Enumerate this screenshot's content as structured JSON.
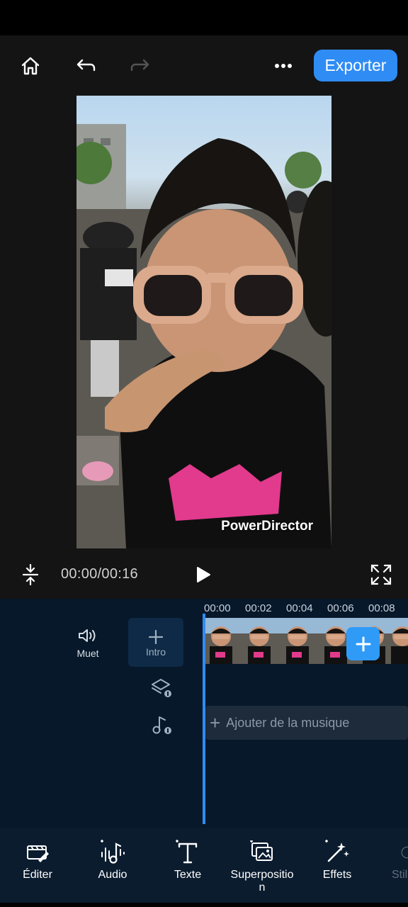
{
  "header": {
    "export_label": "Exporter",
    "icons": [
      "home-icon",
      "undo-icon",
      "redo-icon",
      "more-icon"
    ]
  },
  "preview": {
    "watermark": "PowerDirector"
  },
  "playback": {
    "time": "00:00/00:16"
  },
  "timeline": {
    "ruler": [
      "00:00",
      "00:02",
      "00:04",
      "00:06",
      "00:08"
    ],
    "mute_label": "Muet",
    "intro_label": "Intro",
    "add_music_label": "Ajouter de la musique"
  },
  "toolbar": {
    "items": [
      {
        "label": "Éditer",
        "icon": "edit-icon"
      },
      {
        "label": "Audio",
        "icon": "audio-icon"
      },
      {
        "label": "Texte",
        "icon": "text-icon"
      },
      {
        "label": "Superpositio\nn",
        "icon": "overlay-icon"
      },
      {
        "label": "Effets",
        "icon": "effects-icon"
      },
      {
        "label": "Stil",
        "icon": "sticker-icon"
      }
    ]
  },
  "colors": {
    "accent": "#2f8cf4",
    "timeline_bg": "#07182b",
    "toolbar_bg": "#0b1c2f"
  }
}
